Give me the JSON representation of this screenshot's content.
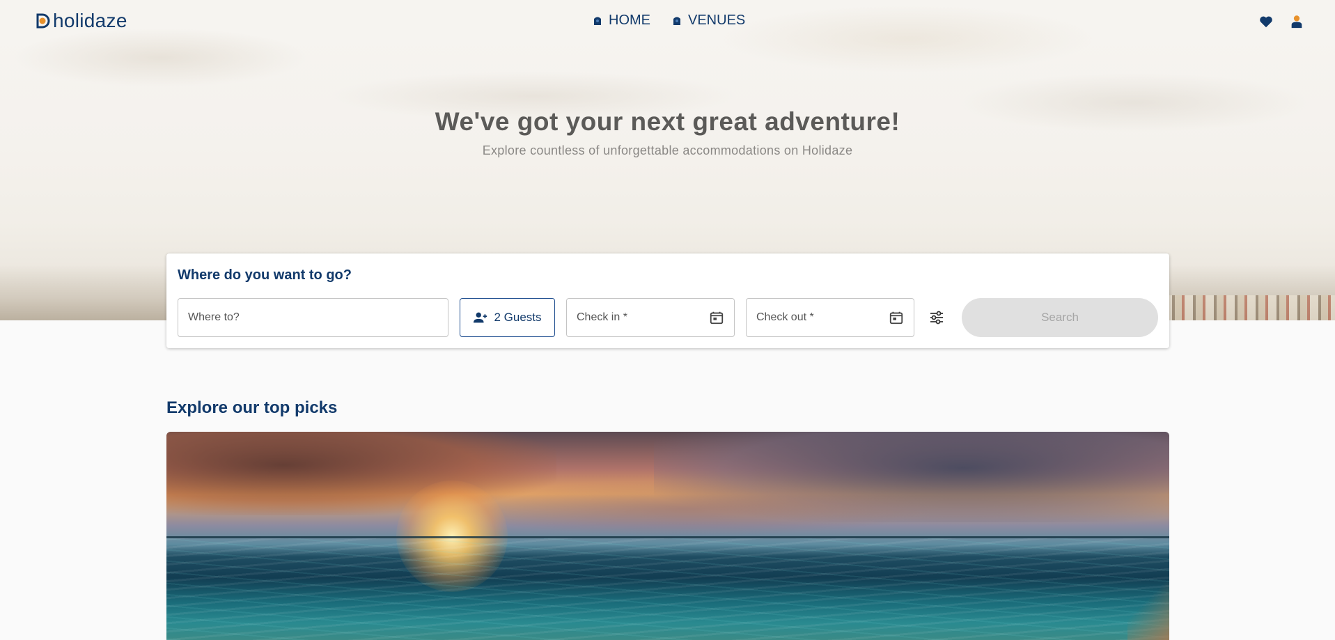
{
  "brand": {
    "name": "holidaze"
  },
  "nav": {
    "links": [
      {
        "label": "HOME"
      },
      {
        "label": "VENUES"
      }
    ]
  },
  "hero": {
    "title": "We've got your next great adventure!",
    "subtitle": "Explore countless of unforgettable accommodations on Holidaze"
  },
  "search": {
    "title": "Where do you want to go?",
    "where_placeholder": "Where to?",
    "guests_label": "2 Guests",
    "checkin_label": "Check in *",
    "checkout_label": "Check out *",
    "submit_label": "Search"
  },
  "picks": {
    "title": "Explore our top picks"
  },
  "colors": {
    "brand_navy": "#123a6b",
    "brand_orange": "#e8912b",
    "button_disabled": "#e0e0e0"
  },
  "icons": {
    "favorites": "heart-icon",
    "profile": "user-icon",
    "nav": "home-badge-icon",
    "guests": "person-add-icon",
    "calendar": "calendar-icon",
    "filters": "sliders-icon"
  }
}
